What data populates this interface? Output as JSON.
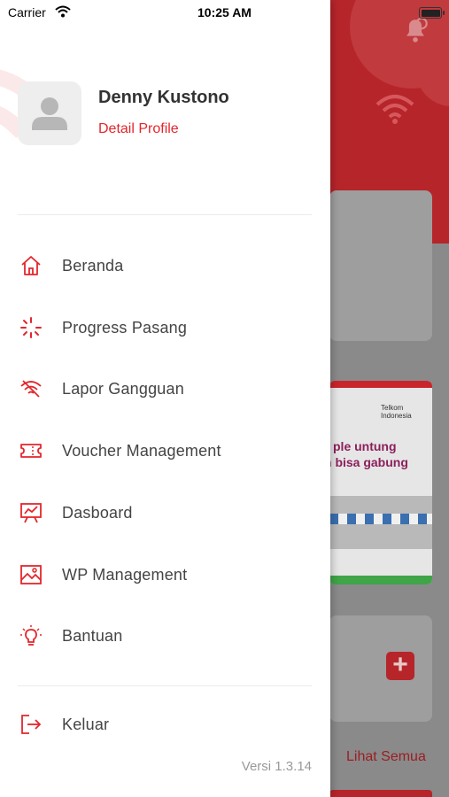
{
  "status_bar": {
    "carrier": "Carrier",
    "time": "10:25 AM"
  },
  "profile": {
    "name": "Denny Kustono",
    "detail_link": "Detail Profile"
  },
  "menu": {
    "items": [
      {
        "label": "Beranda",
        "icon": "home-icon"
      },
      {
        "label": "Progress Pasang",
        "icon": "loading-icon"
      },
      {
        "label": "Lapor Gangguan",
        "icon": "wifi-off-icon"
      },
      {
        "label": "Voucher Management",
        "icon": "ticket-icon"
      },
      {
        "label": "Dasboard",
        "icon": "presentation-chart-icon"
      },
      {
        "label": "WP Management",
        "icon": "image-icon"
      },
      {
        "label": "Bantuan",
        "icon": "lightbulb-icon"
      }
    ],
    "logout": {
      "label": "Keluar",
      "icon": "logout-icon"
    }
  },
  "version": "Versi 1.3.14",
  "background": {
    "banner_line1": "ple untung",
    "banner_line2": "n bisa gabung",
    "banner_brand": "Telkom Indonesia",
    "see_all": "Lihat Semua",
    "add_symbol": "+"
  },
  "colors": {
    "accent": "#e3262c",
    "text": "#444444",
    "muted": "#999999"
  }
}
